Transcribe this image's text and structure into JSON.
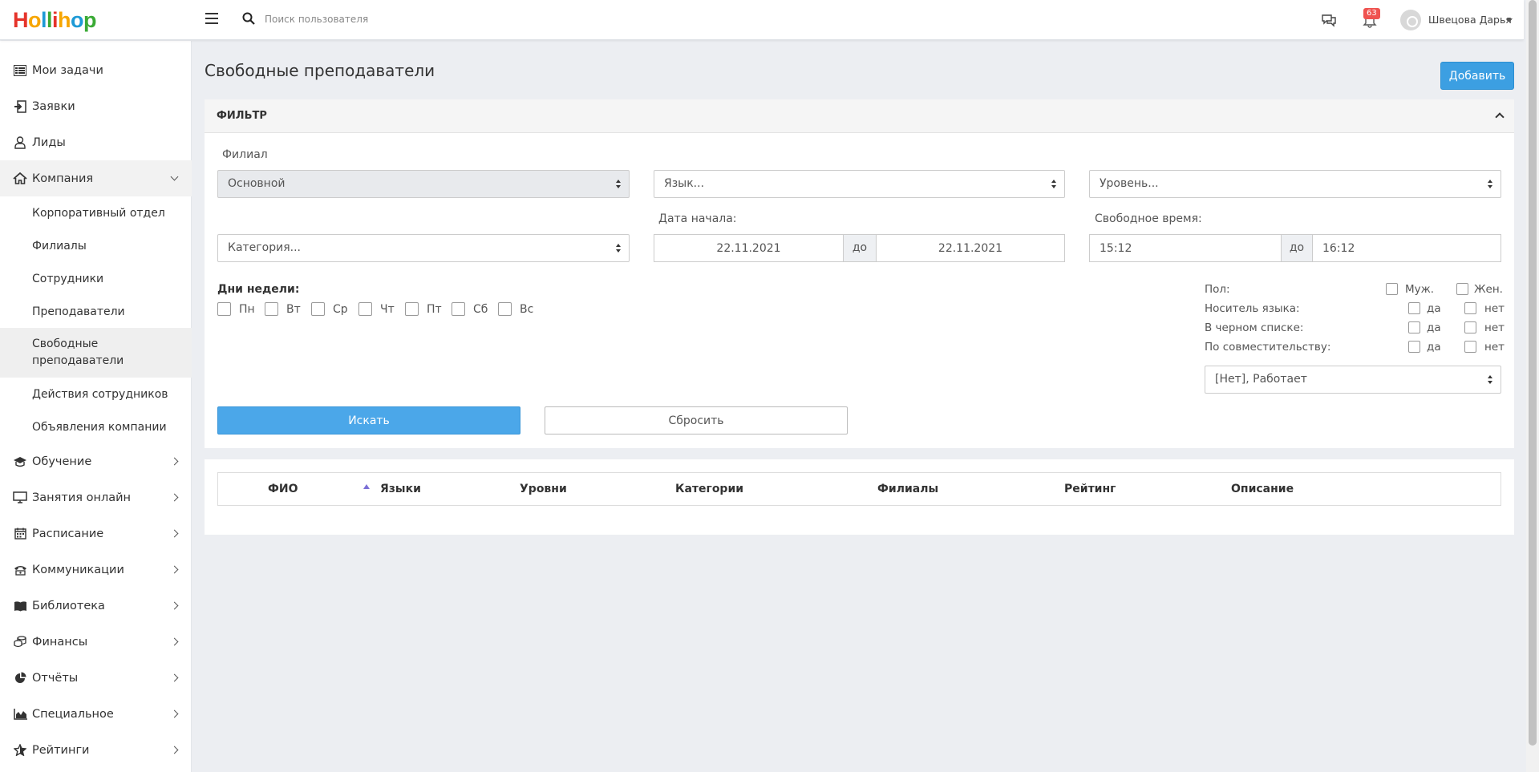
{
  "header": {
    "logo_letters": [
      {
        "ch": "H",
        "color": "#e5332a"
      },
      {
        "ch": "o",
        "color": "#f7a600"
      },
      {
        "ch": "l",
        "color": "#1d9ad6"
      },
      {
        "ch": "l",
        "color": "#3aaa35"
      },
      {
        "ch": "i",
        "color": "#e5332a"
      },
      {
        "ch": "h",
        "color": "#f7a600"
      },
      {
        "ch": "o",
        "color": "#1d9ad6"
      },
      {
        "ch": "p",
        "color": "#3aaa35"
      }
    ],
    "search_placeholder": "Поиск пользователя",
    "notifications_count": "63",
    "user_name": "Швецова Дарья"
  },
  "sidebar": {
    "items": [
      {
        "label": "Мои задачи",
        "icon": "task-list-icon"
      },
      {
        "label": "Заявки",
        "icon": "sign-in-icon"
      },
      {
        "label": "Лиды",
        "icon": "user-icon"
      },
      {
        "label": "Компания",
        "icon": "home-icon",
        "open": true
      },
      {
        "label": "Обучение",
        "icon": "graduation-cap-icon"
      },
      {
        "label": "Занятия онлайн",
        "icon": "monitor-icon"
      },
      {
        "label": "Расписание",
        "icon": "calendar-icon"
      },
      {
        "label": "Коммуникации",
        "icon": "phone-icon"
      },
      {
        "label": "Библиотека",
        "icon": "book-icon"
      },
      {
        "label": "Финансы",
        "icon": "coins-icon"
      },
      {
        "label": "Отчёты",
        "icon": "pie-chart-icon"
      },
      {
        "label": "Специальное",
        "icon": "area-chart-icon"
      },
      {
        "label": "Рейтинги",
        "icon": "star-icon"
      }
    ],
    "company_sub": [
      {
        "label": "Корпоративный отдел"
      },
      {
        "label": "Филиалы"
      },
      {
        "label": "Сотрудники"
      },
      {
        "label": "Преподаватели"
      },
      {
        "label": "Свободные преподаватели",
        "active": true
      },
      {
        "label": "Действия сотрудников"
      },
      {
        "label": "Объявления компании"
      }
    ]
  },
  "page": {
    "title": "Свободные преподаватели",
    "add_button": "Добавить"
  },
  "filter": {
    "title": "ФИЛЬТР",
    "branch_label": "Филиал",
    "branch_value": "Основной",
    "language_placeholder": "Язык...",
    "level_placeholder": "Уровень...",
    "category_placeholder": "Категория...",
    "start_date_label": "Дата начала:",
    "date_from": "22.11.2021",
    "date_sep": "до",
    "date_to": "22.11.2021",
    "free_time_label": "Свободное время:",
    "time_from": "15:12",
    "time_sep": "до",
    "time_to": "16:12",
    "weekdays_label": "Дни недели:",
    "weekdays": [
      "Пн",
      "Вт",
      "Ср",
      "Чт",
      "Пт",
      "Сб",
      "Вс"
    ],
    "gender_label": "Пол:",
    "gender_male": "Муж.",
    "gender_female": "Жен.",
    "native_label": "Носитель языка:",
    "blacklist_label": "В черном списке:",
    "parttime_label": "По совместительству:",
    "yes": "да",
    "no": "нет",
    "status_value": "[Нет], Работает",
    "search_button": "Искать",
    "reset_button": "Сбросить"
  },
  "table": {
    "columns": [
      "ФИО",
      "Языки",
      "Уровни",
      "Категории",
      "Филиалы",
      "Рейтинг",
      "Описание"
    ]
  }
}
